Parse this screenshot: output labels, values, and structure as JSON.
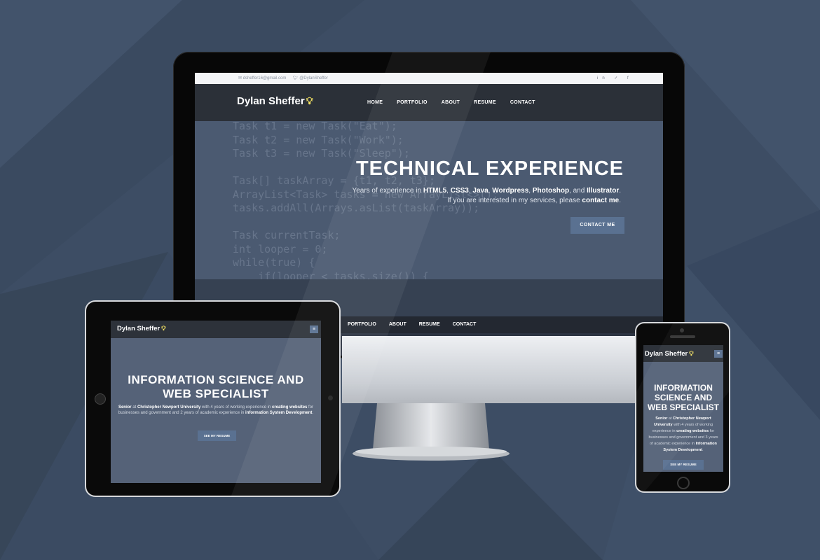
{
  "colors": {
    "background": "#3d4d64",
    "nav_dark": "#2b3038",
    "hero": "#4b5a71",
    "button": "#5a7191",
    "bulb": "#f6e463"
  },
  "desktop": {
    "topbar": {
      "email": "dsheffer16@gmail.com",
      "twitter": "@DylanSheffer",
      "social_icons": [
        "linkedin-icon",
        "twitter-icon",
        "facebook-icon"
      ],
      "social_glyphs": "in ✓ f"
    },
    "brand": "Dylan Sheffer",
    "nav": [
      "HOME",
      "PORTFOLIO",
      "ABOUT",
      "RESUME",
      "CONTACT"
    ],
    "code_lines": [
      "Task t1 = new Task(\"Eat\");",
      "Task t2 = new Task(\"Work\");",
      "Task t3 = new Task(\"Sleep\");",
      "",
      "Task[] taskArray = {t1, t2, t3};",
      "ArrayList<Task> tasks = new ArrayList<>();",
      "tasks.addAll(Arrays.asList(taskArray));",
      "",
      "Task currentTask;",
      "int looper = 0;",
      "while(true) {",
      "    if(looper < tasks.size()) {"
    ],
    "hero": {
      "title": "TECHNICAL EXPERIENCE",
      "line1_prefix": "Years of experience in ",
      "skills": [
        "HTML5",
        "CSS3",
        "Java",
        "Wordpress",
        "Photoshop",
        "Illustrator"
      ],
      "line2_prefix": "If you are interested in my services, please ",
      "line2_link": "contact me",
      "button": "CONTACT ME"
    },
    "sub_nav": [
      "PORTFOLIO",
      "ABOUT",
      "RESUME",
      "CONTACT"
    ]
  },
  "tablet": {
    "brand": "Dylan Sheffer",
    "menu_icon": "≡",
    "title_line1": "INFORMATION SCIENCE AND",
    "title_line2": "WEB SPECIALIST",
    "desc": {
      "role": "Senior",
      "at": " at ",
      "school": "Christopher Newport University",
      "mid": " with 4 years of working experience in ",
      "skill": "creating websites",
      "mid2": " for businesses and government and 2 years of academic experience in ",
      "field": "information System Development",
      "end": "."
    },
    "button": "SEE MY RESUME"
  },
  "phone": {
    "brand": "Dylan Sheffer",
    "menu_icon": "≡",
    "title_lines": [
      "INFORMATION",
      "SCIENCE AND",
      "WEB SPECIALIST"
    ],
    "desc": {
      "role": "Senior",
      "at": " at ",
      "school": "Christopher Newport University",
      "mid": " with 4 years of working experience in ",
      "skill": "creating websites",
      "mid2": " for businesses and government and 3 years of academic experience in ",
      "field": "Information System Development",
      "end": "."
    },
    "button": "SEE MY RESUME"
  }
}
